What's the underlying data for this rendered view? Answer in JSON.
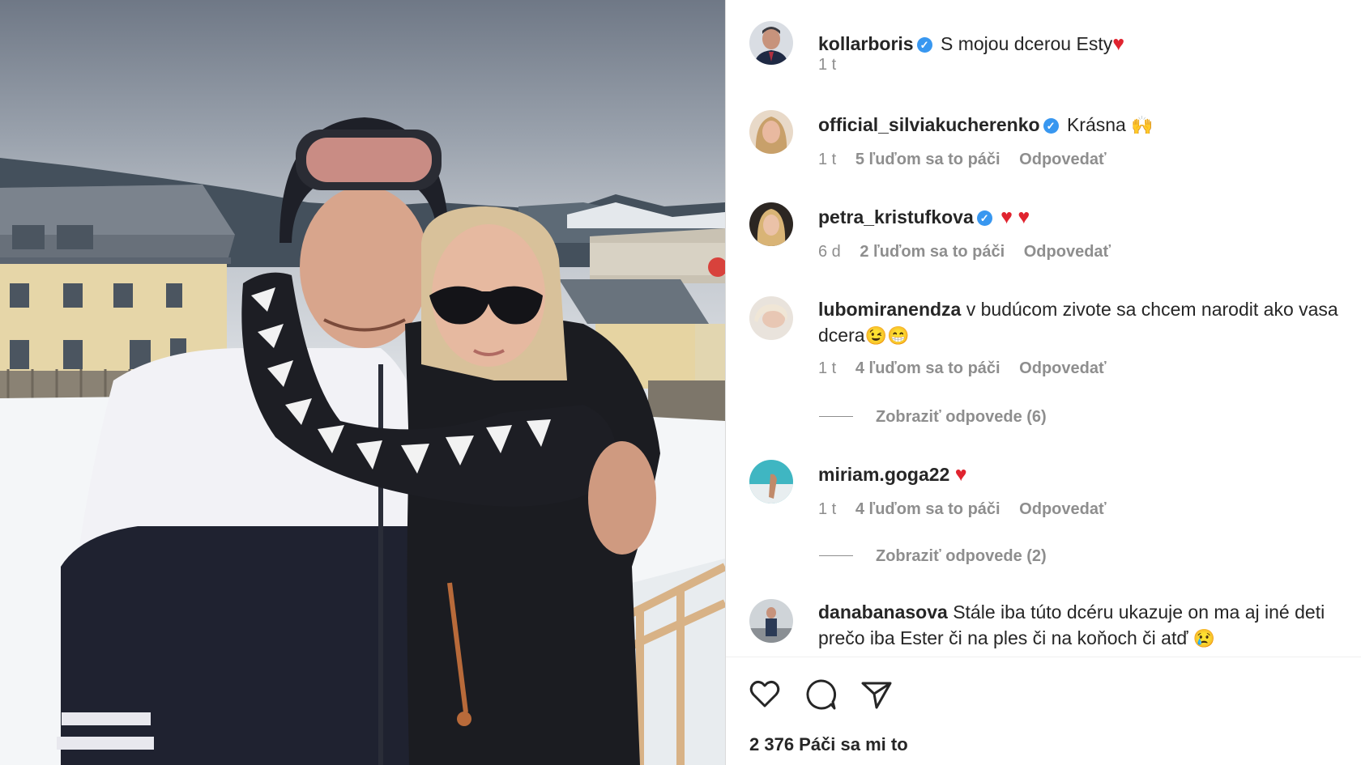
{
  "post": {
    "author": "kollarboris",
    "caption": "S mojou dcerou Esty",
    "age": "1 t",
    "likes_text": "2 376 Páči sa mi to"
  },
  "comments": [
    {
      "username": "official_silviakucherenko",
      "text": "Krásna",
      "emoji": "🙌",
      "age": "1 t",
      "likes": "5 ľuďom sa to páči",
      "reply": "Odpovedať"
    },
    {
      "username": "petra_kristufkova",
      "text": "",
      "age": "6 d",
      "likes": "2 ľuďom sa to páči",
      "reply": "Odpovedať"
    },
    {
      "username": "lubomiranendza",
      "text": "v budúcom zivote sa chcem narodit ako vasa dcera",
      "emoji": "😉😁",
      "age": "1 t",
      "likes": "4 ľuďom sa to páči",
      "reply": "Odpovedať",
      "view_replies": "Zobraziť odpovede (6)"
    },
    {
      "username": "miriam.goga22",
      "text": "",
      "age": "1 t",
      "likes": "4 ľuďom sa to páči",
      "reply": "Odpovedať",
      "view_replies": "Zobraziť odpovede (2)"
    },
    {
      "username": "danabanasova",
      "text": "Stále iba túto dcéru ukazuje on ma aj iné deti prečo iba Ester či na ples či na koňoch či atď",
      "emoji": "😢"
    }
  ],
  "icons": {
    "verified": "verified-badge-icon",
    "like": "heart-outline-icon",
    "comment": "speech-bubble-icon",
    "share": "paper-plane-icon"
  },
  "colors": {
    "verified": "#3897f0",
    "heart": "#e0242f",
    "muted_text": "#8e8e8e"
  }
}
